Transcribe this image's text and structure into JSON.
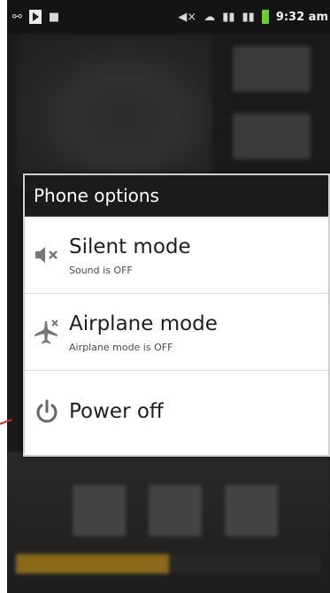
{
  "status_bar": {
    "time": "9:32 am",
    "battery_color": "#6fcf2a",
    "icons": [
      "wifi-icon",
      "video-icon",
      "android-icon",
      "mute-icon",
      "wifi-signal-icon",
      "signal-icon",
      "signal-strong-icon",
      "battery-icon"
    ]
  },
  "dialog": {
    "title": "Phone options",
    "options": [
      {
        "title": "Silent mode",
        "subtitle": "Sound is OFF",
        "icon": "speaker-muted-icon"
      },
      {
        "title": "Airplane mode",
        "subtitle": "Airplane mode is OFF",
        "icon": "airplane-icon"
      },
      {
        "title": "Power off",
        "subtitle": "",
        "icon": "power-icon"
      }
    ]
  },
  "background": {
    "progress_fraction": 0.5
  }
}
